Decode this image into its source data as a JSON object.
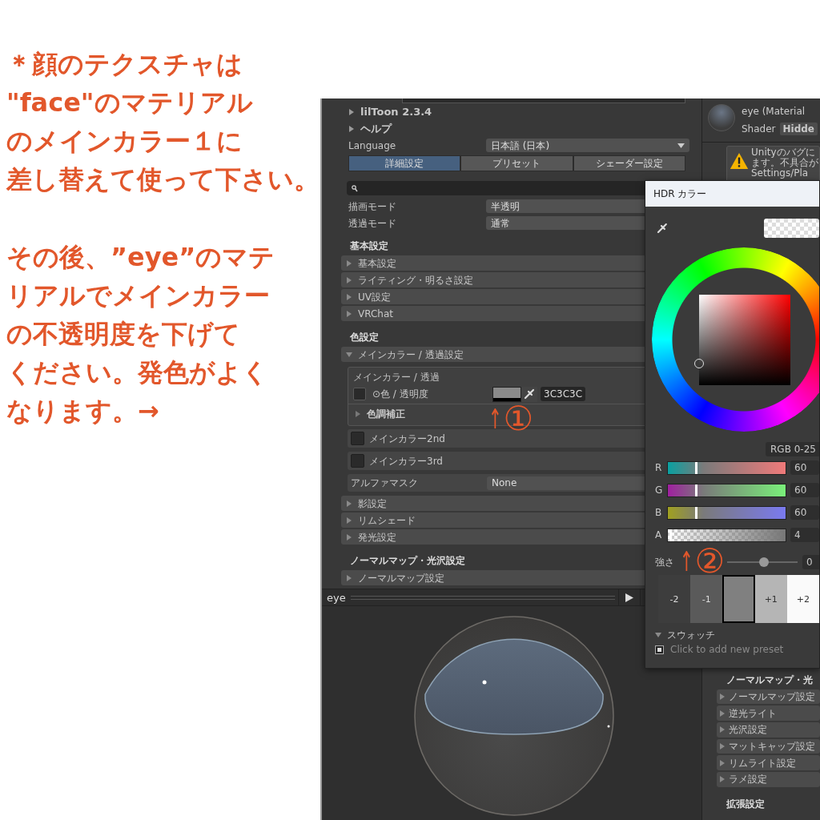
{
  "notes": [
    [
      "＊顔のテクスチャは",
      "\"face\"のマテリアル",
      "のメインカラー１に",
      "差し替えて使って下さい。"
    ],
    [
      "その後、”eye”のマテ",
      "リアルでメインカラー",
      "の不透明度を下げて",
      "ください。発色がよく",
      "なります。→"
    ]
  ],
  "inspector": {
    "top_foldouts": [
      {
        "label": "lilToon 2.3.4",
        "expanded": false
      },
      {
        "label": "ヘルプ",
        "expanded": false
      }
    ],
    "language": {
      "label": "Language",
      "value": "日本語 (日本)"
    },
    "tabs": [
      {
        "label": "詳細設定",
        "selected": true
      },
      {
        "label": "プリセット",
        "selected": false
      },
      {
        "label": "シェーダー設定",
        "selected": false
      }
    ],
    "modes": [
      {
        "label": "描画モード",
        "value": "半透明"
      },
      {
        "label": "透過モード",
        "value": "通常"
      }
    ],
    "sections": [
      {
        "title": "基本設定",
        "items": [
          {
            "kind": "foldout",
            "label": "基本設定",
            "expanded": false
          },
          {
            "kind": "foldout",
            "label": "ライティング・明るさ設定",
            "expanded": false
          },
          {
            "kind": "foldout",
            "label": "UV設定",
            "expanded": false
          },
          {
            "kind": "foldout",
            "label": "VRChat",
            "expanded": false
          }
        ]
      },
      {
        "title": "色設定",
        "items": [
          {
            "kind": "foldout",
            "label": "メインカラー / 透過設定",
            "expanded": true
          },
          {
            "kind": "color_box",
            "title": "メインカラー / 透過",
            "property": "⊙色 / 透明度",
            "hex": "3C3C3C",
            "sub": {
              "label": "色調補正",
              "expanded": false
            }
          },
          {
            "kind": "toggle_box",
            "label": "メインカラー2nd",
            "checked": false
          },
          {
            "kind": "toggle_box",
            "label": "メインカラー3rd",
            "checked": false
          },
          {
            "kind": "field_row",
            "label": "アルファマスク",
            "value": "None"
          },
          {
            "kind": "foldout",
            "label": "影設定",
            "expanded": false
          },
          {
            "kind": "foldout",
            "label": "リムシェード",
            "expanded": false
          },
          {
            "kind": "foldout",
            "label": "発光設定",
            "expanded": false
          }
        ]
      },
      {
        "title": "ノーマルマップ・光沢設定",
        "items": [
          {
            "kind": "foldout",
            "label": "ノーマルマップ設定",
            "expanded": false
          }
        ]
      }
    ],
    "preview": {
      "title": "eye"
    }
  },
  "side": {
    "material_title": "eye (Material",
    "shader_label": "Shader",
    "shader_value": "Hidde",
    "warning_lines": [
      "Unityのバグに",
      "ます。不具合が",
      "Settings/Pla"
    ],
    "sections": [
      {
        "title": "ノーマルマップ・光",
        "items": [
          {
            "label": "ノーマルマップ設定",
            "expanded": false
          },
          {
            "label": "逆光ライト",
            "expanded": false
          },
          {
            "label": "光沢設定",
            "expanded": false
          },
          {
            "label": "マットキャップ設定",
            "expanded": false
          },
          {
            "label": "リムライト設定",
            "expanded": false
          },
          {
            "label": "ラメ設定",
            "expanded": false
          }
        ]
      },
      {
        "title": "拡張設定"
      }
    ]
  },
  "hdr_popup": {
    "title": "HDR カラー",
    "mode": "RGB 0-25",
    "channels": [
      {
        "kind": "r",
        "label": "R",
        "level": 0.235,
        "value": "60"
      },
      {
        "kind": "g",
        "label": "G",
        "level": 0.235,
        "value": "60"
      },
      {
        "kind": "b",
        "label": "B",
        "level": 0.235,
        "value": "60"
      },
      {
        "kind": "a",
        "label": "A",
        "level": 0.016,
        "value": "4"
      }
    ],
    "intensity": {
      "label": "強さ",
      "level": 0.52,
      "value": "0"
    },
    "exposures": [
      {
        "label": "-2",
        "selected": false
      },
      {
        "label": "-1",
        "selected": false
      },
      {
        "selected": true
      },
      {
        "label": "+1",
        "selected": false
      },
      {
        "label": "+2",
        "selected": false
      }
    ],
    "swatches": {
      "label": "スウォッチ",
      "expanded": true,
      "hint": "Click to add new preset"
    }
  },
  "annotations": [
    {
      "arrow": "↑",
      "label": "①"
    },
    {
      "arrow": "↑",
      "label": "②"
    }
  ]
}
